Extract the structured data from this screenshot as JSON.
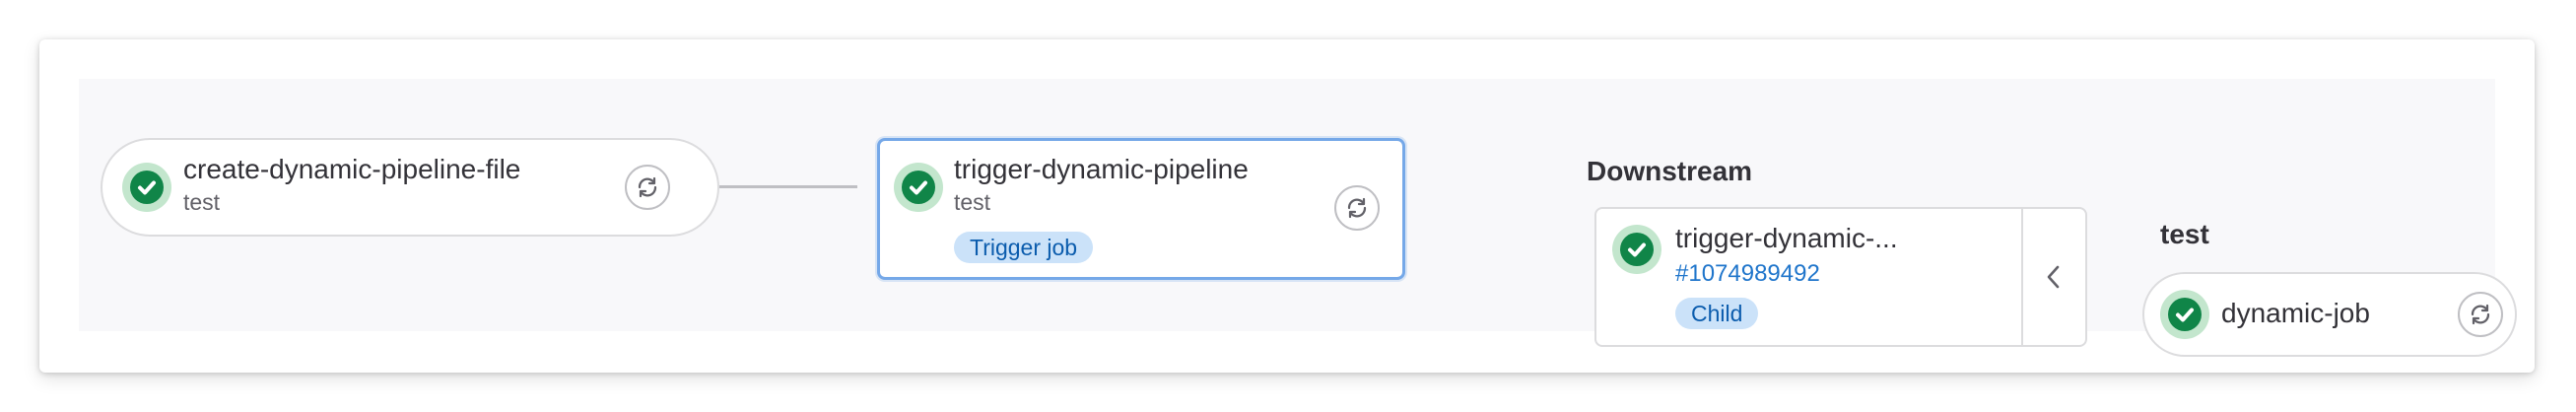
{
  "jobs": {
    "create": {
      "name": "create-dynamic-pipeline-file",
      "stage": "test"
    },
    "trigger": {
      "name": "trigger-dynamic-pipeline",
      "stage": "test",
      "badge": "Trigger job"
    },
    "dynamic": {
      "name": "dynamic-job"
    }
  },
  "downstream": {
    "title": "Downstream",
    "name": "trigger-dynamic-...",
    "pipeline_id": "#1074989492",
    "badge": "Child"
  },
  "test_stage": {
    "title": "test"
  },
  "icons": {
    "status": "check-circle-icon",
    "retry": "retry-icon",
    "collapse": "chevron-left-icon"
  },
  "colors": {
    "success": "#108548",
    "success_bg": "#c3e6cd",
    "link": "#1f75cb",
    "badge_bg": "#cbe2f9",
    "badge_text": "#0b5cad",
    "selected_border": "#75a8e8"
  }
}
